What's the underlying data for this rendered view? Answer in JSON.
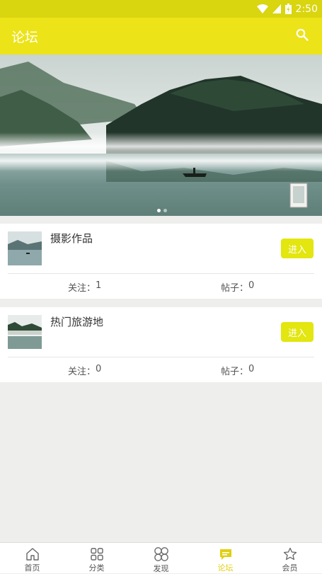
{
  "status_bar": {
    "time": "2:50"
  },
  "app_bar": {
    "title": "论坛"
  },
  "banner": {
    "dots": 2,
    "active_dot": 0
  },
  "forums": [
    {
      "title": "摄影作品",
      "enter_label": "进入",
      "follow_label": "关注：",
      "follow_count": "1",
      "posts_label": "帖子：",
      "posts_count": "0"
    },
    {
      "title": "热门旅游地",
      "enter_label": "进入",
      "follow_label": "关注：",
      "follow_count": "0",
      "posts_label": "帖子：",
      "posts_count": "0"
    }
  ],
  "bottom_nav": [
    {
      "label": "首页",
      "icon": "home-icon"
    },
    {
      "label": "分类",
      "icon": "grid-icon"
    },
    {
      "label": "发现",
      "icon": "discover-icon"
    },
    {
      "label": "论坛",
      "icon": "forum-icon",
      "active": true
    },
    {
      "label": "会员",
      "icon": "star-icon"
    }
  ],
  "colors": {
    "accent": "#ece318",
    "status_bar": "#d9d50f",
    "enter_button": "#e3e60f",
    "active_nav": "#e0cf10"
  }
}
